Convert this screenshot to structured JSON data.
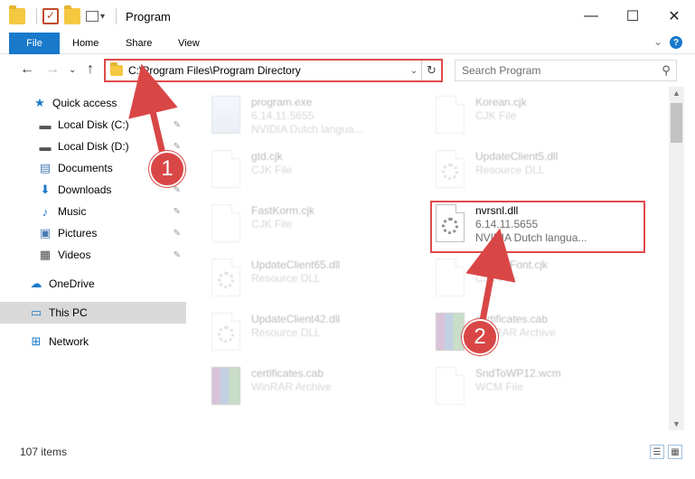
{
  "window": {
    "title": "Program",
    "minimize_glyph": "—",
    "maximize_glyph": "☐",
    "close_glyph": "✕"
  },
  "ribbon": {
    "tabs": [
      "File",
      "Home",
      "Share",
      "View"
    ],
    "help_glyph": "?",
    "expand_glyph": "⌄"
  },
  "nav": {
    "back_glyph": "←",
    "forward_glyph": "→",
    "recent_glyph": "⌄",
    "up_glyph": "↑"
  },
  "address": {
    "path": "C:\\Program Files\\Program Directory",
    "dropdown_glyph": "⌄",
    "refresh_glyph": "↻"
  },
  "search": {
    "placeholder": "Search Program",
    "icon_glyph": "⚲"
  },
  "sidebar": {
    "items": [
      {
        "label": "Quick access",
        "icon": "star-icon",
        "glyph": "★",
        "color": "#1979ca"
      },
      {
        "label": "Local Disk (C:)",
        "icon": "drive-icon",
        "glyph": "▬",
        "color": "#555555"
      },
      {
        "label": "Local Disk (D:)",
        "icon": "drive-icon",
        "glyph": "▬",
        "color": "#555555"
      },
      {
        "label": "Documents",
        "icon": "documents-icon",
        "glyph": "▤",
        "color": "#4a7ab5"
      },
      {
        "label": "Downloads",
        "icon": "download-icon",
        "glyph": "⬇",
        "color": "#1979ca"
      },
      {
        "label": "Music",
        "icon": "music-icon",
        "glyph": "♪",
        "color": "#1979ca"
      },
      {
        "label": "Pictures",
        "icon": "pictures-icon",
        "glyph": "▣",
        "color": "#4a7ab5"
      },
      {
        "label": "Videos",
        "icon": "videos-icon",
        "glyph": "▦",
        "color": "#4a4a4a"
      },
      {
        "label": "OneDrive",
        "icon": "cloud-icon",
        "glyph": "☁",
        "color": "#1979ca"
      },
      {
        "label": "This PC",
        "icon": "computer-icon",
        "glyph": "▭",
        "color": "#1979ca"
      },
      {
        "label": "Network",
        "icon": "network-icon",
        "glyph": "⊞",
        "color": "#1979ca"
      }
    ],
    "pin_glyph": "✎"
  },
  "files": [
    {
      "name": "program.exe",
      "line2": "6.14.11.5655",
      "line3": "NVIDIA Dutch langua...",
      "icon": "exe"
    },
    {
      "name": "Korean.cjk",
      "line2": "CJK File",
      "line3": "",
      "icon": "doc"
    },
    {
      "name": "gtd.cjk",
      "line2": "CJK File",
      "line3": "",
      "icon": "doc"
    },
    {
      "name": "UpdateClient5.dll",
      "line2": "Resource DLL",
      "line3": "",
      "icon": "gear"
    },
    {
      "name": "FastKorm.cjk",
      "line2": "CJK File",
      "line3": "",
      "icon": "doc"
    },
    {
      "name": "nvrsnl.dll",
      "line2": "6.14.11.5655",
      "line3": "NVIDIA Dutch langua...",
      "icon": "gear"
    },
    {
      "name": "UpdateClient65.dll",
      "line2": "Resource DLL",
      "line3": "",
      "icon": "gear"
    },
    {
      "name": "DefaultFont.cjk",
      "line2": "CJK File",
      "line3": "",
      "icon": "doc"
    },
    {
      "name": "UpdateClient42.dll",
      "line2": "Resource DLL",
      "line3": "",
      "icon": "gear"
    },
    {
      "name": "certificates.cab",
      "line2": "WinRAR Archive",
      "line3": "",
      "icon": "rar"
    },
    {
      "name": "certificates.cab",
      "line2": "WinRAR Archive",
      "line3": "",
      "icon": "rar"
    },
    {
      "name": "SndToWP12.wcm",
      "line2": "WCM File",
      "line3": "",
      "icon": "doc"
    }
  ],
  "status": {
    "item_count": "107 items",
    "details_view_glyph": "☰",
    "tiles_view_glyph": "▦"
  },
  "callouts": {
    "step1": "1",
    "step2": "2",
    "color": "#d94646"
  },
  "colors": {
    "accent": "#1979ca",
    "highlight": "#e04a4a"
  }
}
